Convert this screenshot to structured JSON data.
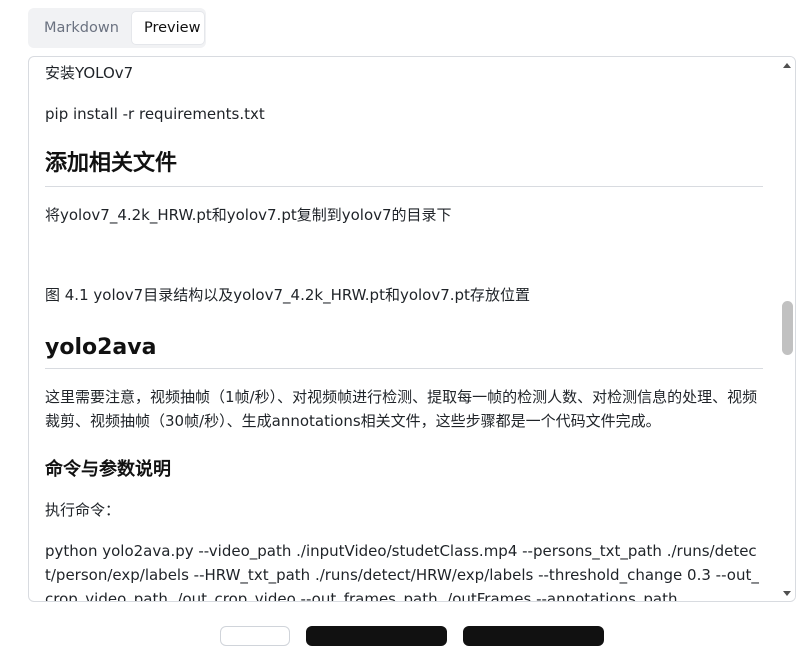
{
  "tabs": {
    "markdown": "Markdown",
    "preview": "Preview"
  },
  "doc": {
    "install_heading": "安装YOLOv7",
    "pip_cmd": "pip install -r requirements.txt",
    "h2_add_files": "添加相关文件",
    "copy_text": "将yolov7_4.2k_HRW.pt和yolov7.pt复制到yolov7的目录下",
    "figure_caption": "图 4.1 yolov7目录结构以及yolov7_4.2k_HRW.pt和yolov7.pt存放位置",
    "h2_yolo2ava": "yolo2ava",
    "note_text": "这里需要注意，视频抽帧（1帧/秒）、对视频帧进行检测、提取每一帧的检测人数、对检测信息的处理、视频裁剪、视频抽帧（30帧/秒）、生成annotations相关文件，这些步骤都是一个代码文件完成。",
    "h3_cmd": "命令与参数说明",
    "exec_label": "执行命令：",
    "python_cmd": "python yolo2ava.py --video_path ./inputVideo/studetClass.mp4 --persons_txt_path ./runs/detect/person/exp/labels --HRW_txt_path ./runs/detect/HRW/exp/labels --threshold_change 0.3 --out_crop_video_path ./out_crop_video --out_frames_path ./outFrames --annotations_path"
  },
  "colors": {
    "accent_dark": "#111111",
    "border": "#d8dbe0",
    "tab_bg": "#f1f2f4"
  }
}
